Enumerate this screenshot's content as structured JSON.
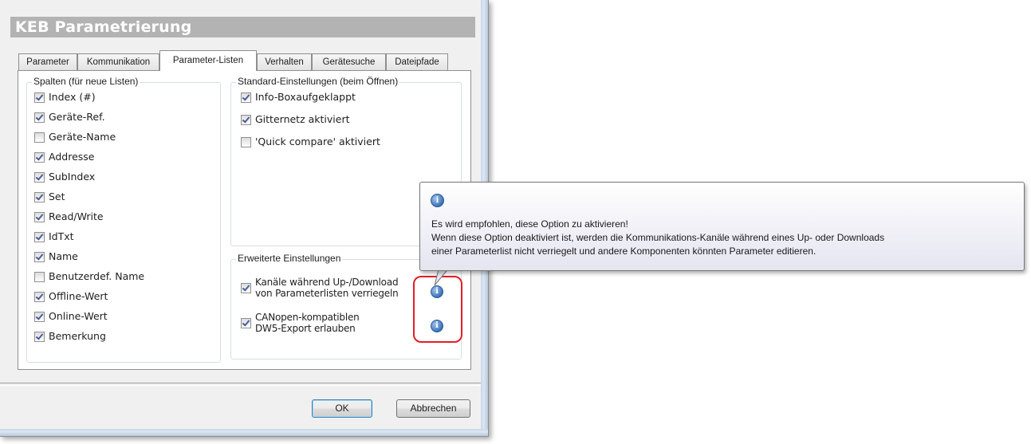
{
  "dialog": {
    "title": "KEB Parametrierung",
    "tabs": [
      {
        "label": "Parameter",
        "active": false
      },
      {
        "label": "Kommunikation",
        "active": false
      },
      {
        "label": "Parameter-Listen",
        "active": true
      },
      {
        "label": "Verhalten",
        "active": false
      },
      {
        "label": "Gerätesuche",
        "active": false
      },
      {
        "label": "Dateipfade",
        "active": false
      }
    ],
    "columns_group": {
      "title": "Spalten (für neue Listen)",
      "items": [
        {
          "label": "Index (#)",
          "checked": true
        },
        {
          "label": "Geräte-Ref.",
          "checked": true
        },
        {
          "label": "Geräte-Name",
          "checked": false
        },
        {
          "label": "Addresse",
          "checked": true
        },
        {
          "label": "SubIndex",
          "checked": true
        },
        {
          "label": "Set",
          "checked": true
        },
        {
          "label": "Read/Write",
          "checked": true
        },
        {
          "label": "IdTxt",
          "checked": true
        },
        {
          "label": "Name",
          "checked": true
        },
        {
          "label": "Benutzerdef. Name",
          "checked": false
        },
        {
          "label": "Offline-Wert",
          "checked": true
        },
        {
          "label": "Online-Wert",
          "checked": true
        },
        {
          "label": "Bemerkung",
          "checked": true
        }
      ]
    },
    "standard_group": {
      "title": "Standard-Einstellungen (beim Öffnen)",
      "items": [
        {
          "label": "Info-Boxaufgeklappt",
          "checked": true
        },
        {
          "label": "Gitternetz aktiviert",
          "checked": true
        },
        {
          "label": "'Quick compare' aktiviert",
          "checked": false
        }
      ]
    },
    "advanced_group": {
      "title": "Erweiterte Einstellungen",
      "items": [
        {
          "line1": "Kanäle während Up-/Download",
          "line2": "von Parameterlisten verriegeln",
          "checked": true
        },
        {
          "line1": "CANopen-kompatiblen",
          "line2": "DW5-Export erlauben",
          "checked": true
        }
      ]
    },
    "buttons": {
      "ok": "OK",
      "cancel": "Abbrechen"
    },
    "info_icon_glyph": "i"
  },
  "tooltip": {
    "icon": "info-icon",
    "line1": "Es wird empfohlen, diese Option zu aktivieren!",
    "line2": "Wenn diese Option deaktiviert ist, werden die Kommunikations-Kanäle während eines Up- oder Downloads",
    "line3": "einer Parameterlist nicht verriegelt und andere Komponenten könnten Parameter editieren."
  },
  "colors": {
    "header_bar": "#b3b3b3",
    "highlight": "#e31e26",
    "check": "#4a5f97",
    "info": "#3f73b9"
  }
}
